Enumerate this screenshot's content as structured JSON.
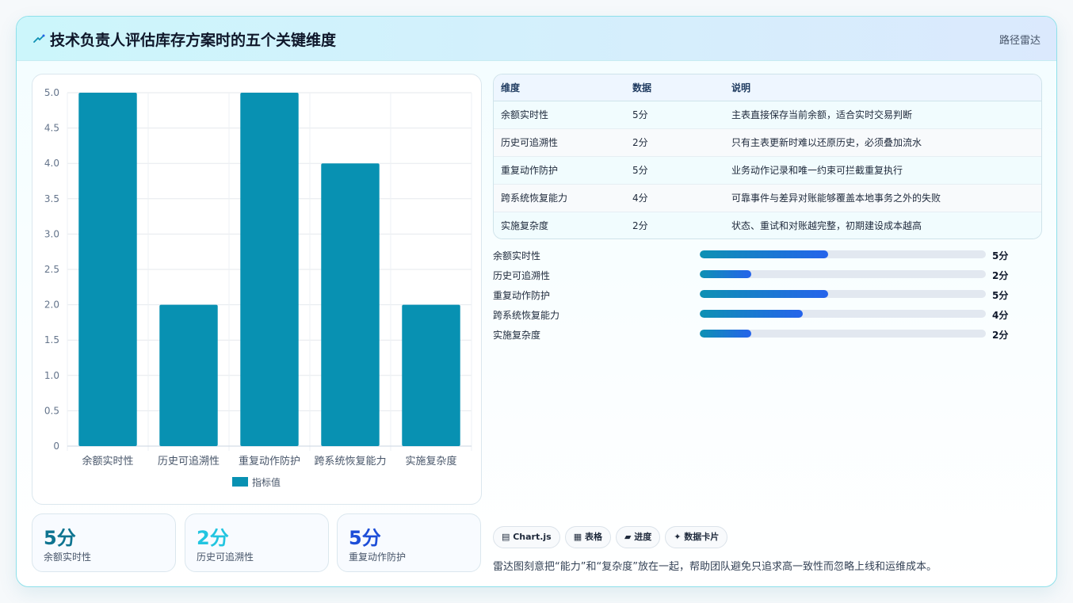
{
  "header": {
    "title": "技术负责人评估库存方案时的五个关键维度",
    "tag": "路径雷达",
    "icon": "sparkle-icon"
  },
  "chart_data": {
    "type": "bar",
    "categories": [
      "余额实时性",
      "历史可追溯性",
      "重复动作防护",
      "跨系统恢复能力",
      "实施复杂度"
    ],
    "series": [
      {
        "name": "指标值",
        "values": [
          5,
          2,
          5,
          4,
          2
        ]
      }
    ],
    "ylim": [
      0,
      5
    ],
    "yticks": [
      "0",
      "0.5",
      "1.0",
      "1.5",
      "2.0",
      "2.5",
      "3.0",
      "3.5",
      "4.0",
      "4.5",
      "5.0"
    ],
    "bar_color": "#0891b2",
    "grid": true,
    "legend": "bottom"
  },
  "kpis": [
    {
      "value": "5分",
      "label": "余额实时性",
      "color": "#0e7490"
    },
    {
      "value": "2分",
      "label": "历史可追溯性",
      "color": "#22c5e0"
    },
    {
      "value": "5分",
      "label": "重复动作防护",
      "color": "#1d4ed8"
    }
  ],
  "table": {
    "headers": [
      "维度",
      "数据",
      "说明"
    ],
    "rows": [
      [
        "余额实时性",
        "5分",
        "主表直接保存当前余额，适合实时交易判断"
      ],
      [
        "历史可追溯性",
        "2分",
        "只有主表更新时难以还原历史，必须叠加流水"
      ],
      [
        "重复动作防护",
        "5分",
        "业务动作记录和唯一约束可拦截重复执行"
      ],
      [
        "跨系统恢复能力",
        "4分",
        "可靠事件与差异对账能够覆盖本地事务之外的失败"
      ],
      [
        "实施复杂度",
        "2分",
        "状态、重试和对账越完整，初期建设成本越高"
      ]
    ]
  },
  "progress": [
    {
      "label": "余额实时性",
      "value": "5分",
      "fraction": 0.45
    },
    {
      "label": "历史可追溯性",
      "value": "2分",
      "fraction": 0.18
    },
    {
      "label": "重复动作防护",
      "value": "5分",
      "fraction": 0.45
    },
    {
      "label": "跨系统恢复能力",
      "value": "4分",
      "fraction": 0.36
    },
    {
      "label": "实施复杂度",
      "value": "2分",
      "fraction": 0.18
    }
  ],
  "chips": [
    {
      "label": "▤ Chart.js",
      "name": "chip-chartjs"
    },
    {
      "label": "▦ 表格",
      "name": "chip-table"
    },
    {
      "label": "▰ 进度",
      "name": "chip-progress"
    },
    {
      "label": "✦ 数据卡片",
      "name": "chip-data-card"
    }
  ],
  "footnote": "雷达图刻意把“能力”和“复杂度”放在一起，帮助团队避免只追求高一致性而忽略上线和运维成本。"
}
